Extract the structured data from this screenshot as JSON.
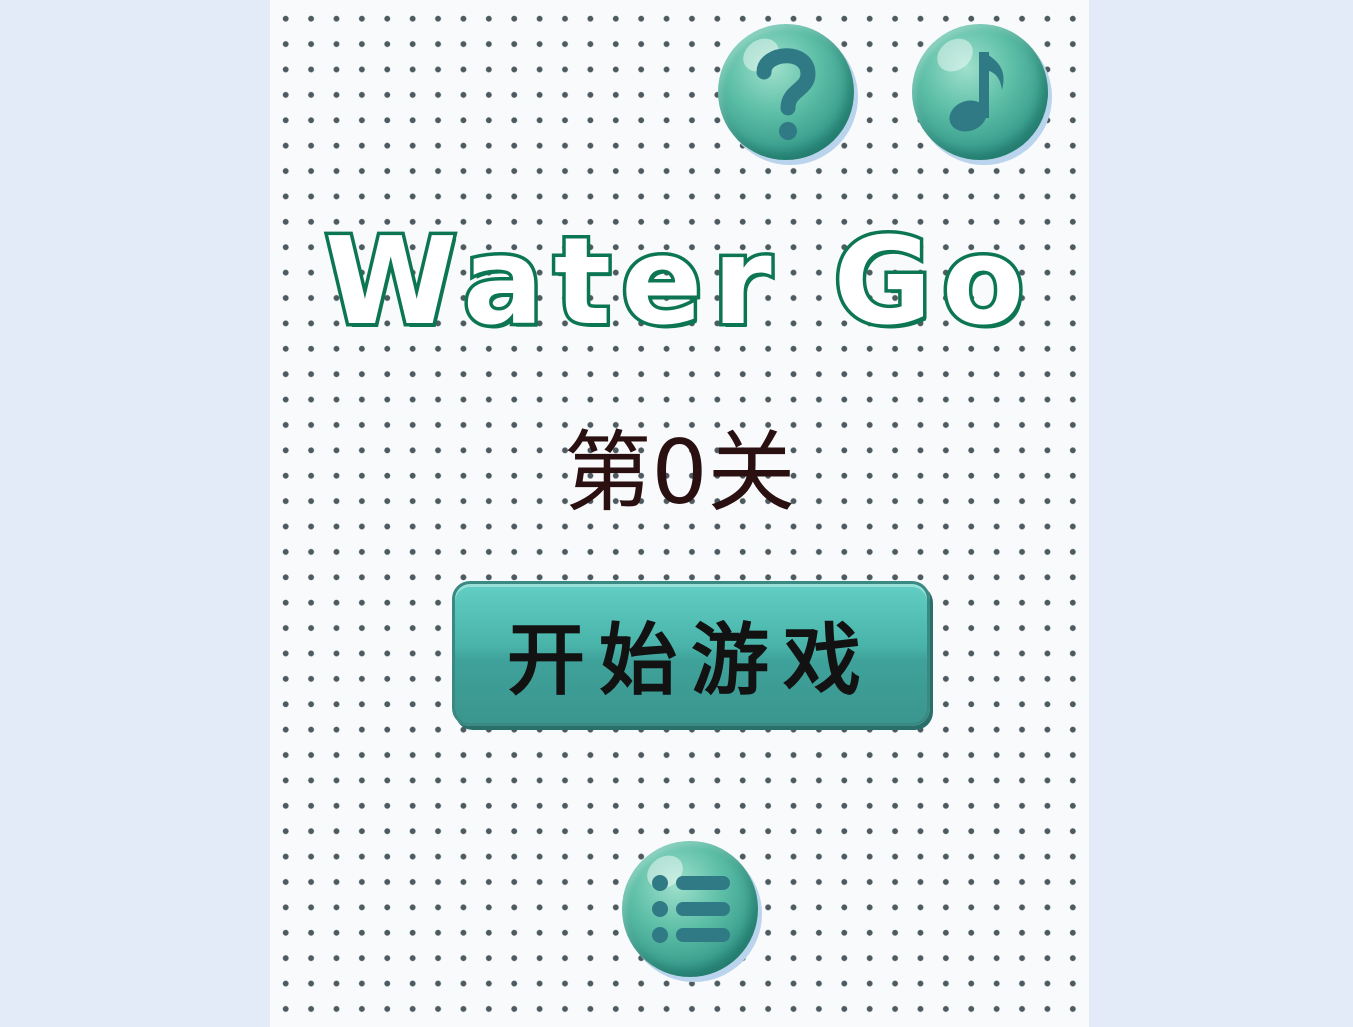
{
  "game": {
    "title": "Water Go",
    "level_label": "第0关",
    "start_button_label": "开始游戏"
  },
  "icons": {
    "help": "question-mark-icon",
    "music": "music-note-icon",
    "menu": "list-menu-icon"
  },
  "colors": {
    "page_background": "#e3eaf8",
    "panel_background": "#f8fafc",
    "title_outline": "#0c7652",
    "bubble_teal": "#5cbea6",
    "button_teal": "#49b3a9",
    "icon_dark": "#2f7a85"
  }
}
